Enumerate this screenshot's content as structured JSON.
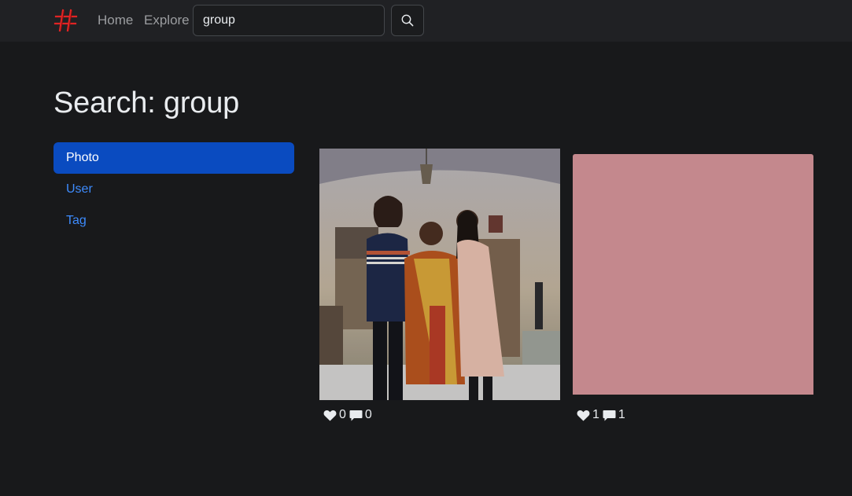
{
  "nav": {
    "home_label": "Home",
    "explore_label": "Explore",
    "search_value": "group",
    "brand_icon": "hashtag-logo-icon",
    "search_icon": "search-icon"
  },
  "page": {
    "title": "Search: group"
  },
  "sidebar": {
    "items": [
      {
        "label": "Photo",
        "active": true
      },
      {
        "label": "User",
        "active": false
      },
      {
        "label": "Tag",
        "active": false
      }
    ]
  },
  "results": [
    {
      "kind": "photo",
      "likes": "0",
      "comments": "0"
    },
    {
      "kind": "placeholder",
      "color": "#c4888d",
      "likes": "1",
      "comments": "1"
    }
  ],
  "colors": {
    "background": "#18191b",
    "navbar": "#202124",
    "accent": "#0a4bc0",
    "link": "#3d8bfd",
    "brand": "#e02424"
  }
}
